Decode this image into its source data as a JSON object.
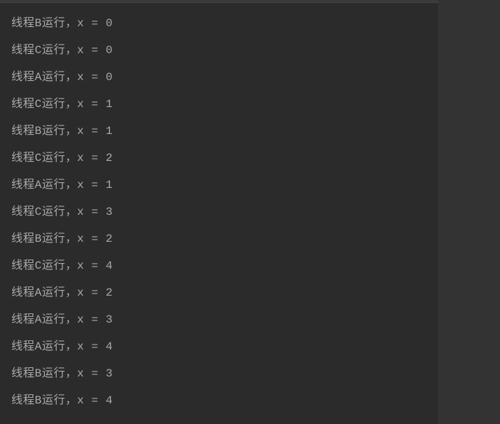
{
  "console": {
    "lines": [
      "线程B运行，x = 0",
      "线程C运行，x = 0",
      "线程A运行，x = 0",
      "线程C运行，x = 1",
      "线程B运行，x = 1",
      "线程C运行，x = 2",
      "线程A运行，x = 1",
      "线程C运行，x = 3",
      "线程B运行，x = 2",
      "线程C运行，x = 4",
      "线程A运行，x = 2",
      "线程A运行，x = 3",
      "线程A运行，x = 4",
      "线程B运行，x = 3",
      "线程B运行，x = 4"
    ]
  }
}
